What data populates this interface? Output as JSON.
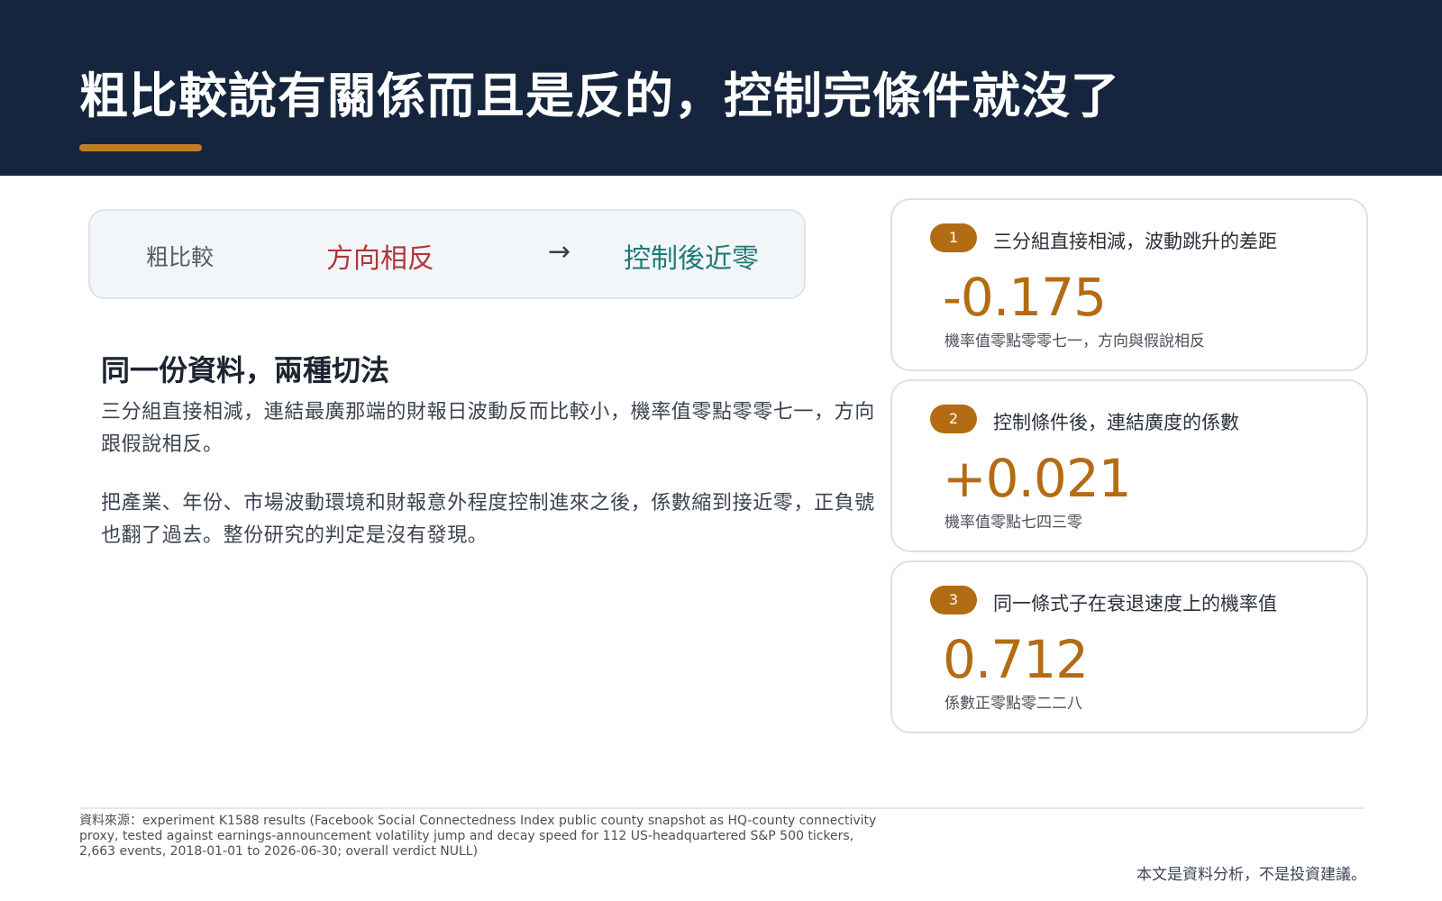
{
  "title": "粗比較說有關係而且是反的，控制完條件就沒了",
  "flow": {
    "label": "粗比較",
    "opposite": "方向相反",
    "arrow": "→",
    "near_zero": "控制後近零"
  },
  "section": {
    "heading": "同一份資料，兩種切法",
    "paragraph1": "三分組直接相減，連結最廣那端的財報日波動反而比較小，機率值零點零零七一，方向跟假說相反。",
    "paragraph2": "把產業、年份、市場波動環境和財報意外程度控制進來之後，係數縮到接近零，正負號也翻了過去。整份研究的判定是沒有發現。"
  },
  "cards": [
    {
      "badge": "1",
      "label": "三分組直接相減，波動跳升的差距",
      "value": "-0.175",
      "note": "機率值零點零零七一，方向與假說相反"
    },
    {
      "badge": "2",
      "label": "控制條件後，連結廣度的係數",
      "value": "+0.021",
      "note": "機率值零點七四三零"
    },
    {
      "badge": "3",
      "label": "同一條式子在衰退速度上的機率值",
      "value": "0.712",
      "note": "係數正零點零二二八"
    }
  ],
  "footer": {
    "source": "資料來源：experiment K1588 results (Facebook Social Connectedness Index public county snapshot as HQ-county connectivity proxy, tested against earnings-announcement volatility jump and decay speed for 112 US-headquartered S&P 500 tickers, 2,663 events, 2018-01-01 to 2026-06-30; overall verdict NULL)",
    "disclaimer": "本文是資料分析，不是投資建議。"
  },
  "colors": {
    "header_bg": "#15253d",
    "accent": "#c17d22",
    "value": "#b36c14",
    "opposite": "#b0363a",
    "near_zero": "#1f7a78"
  }
}
